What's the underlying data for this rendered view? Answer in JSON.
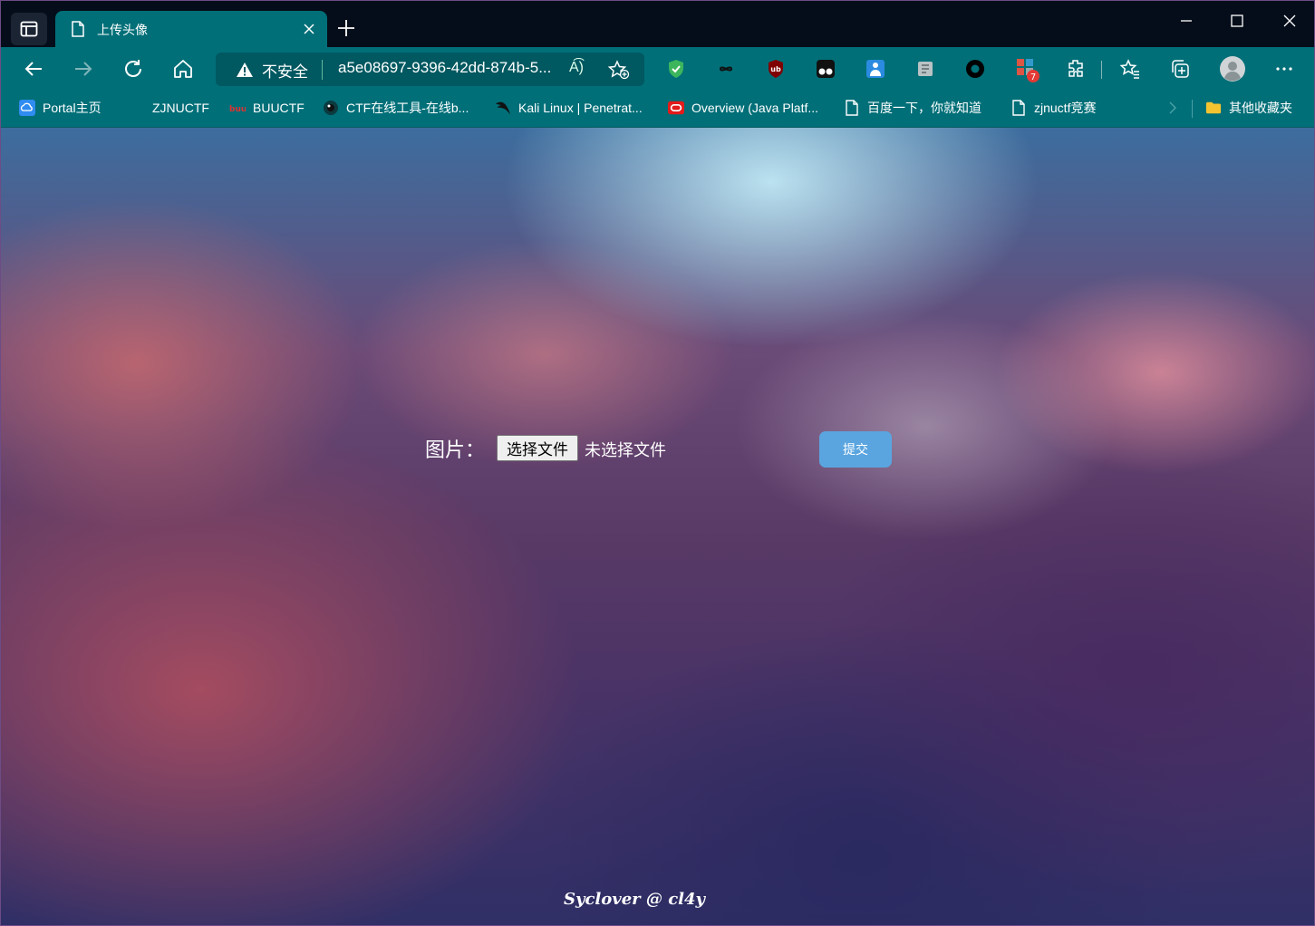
{
  "tab": {
    "title": "上传头像"
  },
  "address_bar": {
    "security_label": "不安全",
    "url": "a5e08697-9396-42dd-874b-5...",
    "read_aloud_label": "A͡)"
  },
  "extensions": {
    "notification_badge": "7"
  },
  "bookmarks": [
    {
      "label": "Portal主页"
    },
    {
      "label": "ZJNUCTF"
    },
    {
      "label": "BUUCTF"
    },
    {
      "label": "CTF在线工具-在线b..."
    },
    {
      "label": "Kali Linux | Penetrat..."
    },
    {
      "label": "Overview (Java Platf..."
    },
    {
      "label": "百度一下，你就知道"
    },
    {
      "label": "zjnuctf竞赛"
    }
  ],
  "other_bookmarks": {
    "label": "其他收藏夹"
  },
  "page": {
    "image_label": "图片：",
    "file_button": "选择文件",
    "no_file": "未选择文件",
    "submit": "提交",
    "footer": "Syclover @ cl4y"
  },
  "colors": {
    "toolbar": "#006f78",
    "titlebar": "#050d1a",
    "submit_button": "#5aa5e0"
  }
}
